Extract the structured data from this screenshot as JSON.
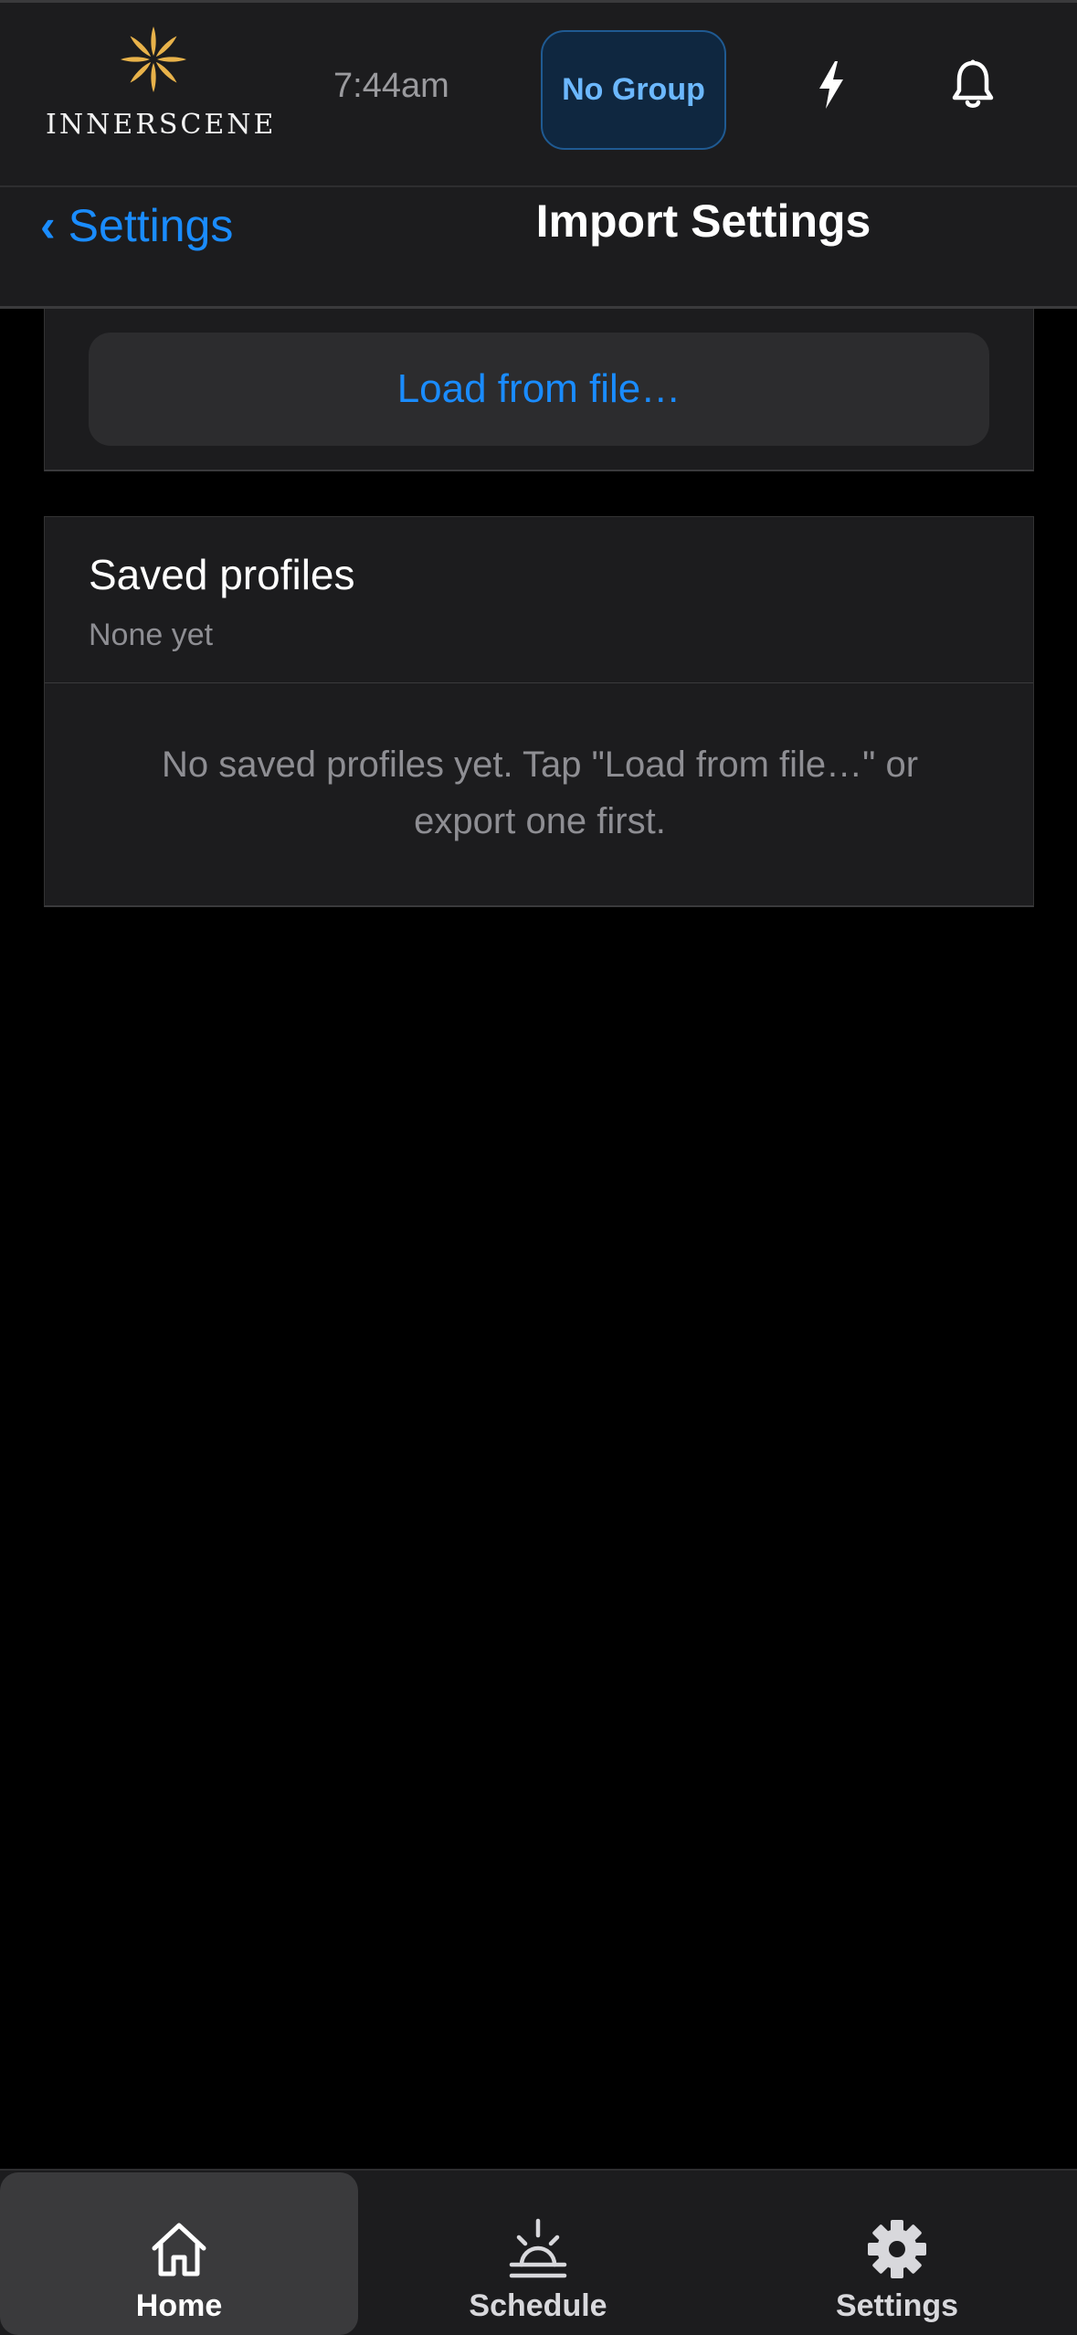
{
  "header": {
    "brand": "INNERSCENE",
    "time": "7:44am",
    "group_label": "No Group",
    "icons": {
      "logo": "sunburst-logo",
      "power": "lightning-bolt-icon",
      "notifications": "bell-icon"
    },
    "colors": {
      "logo_gold": "#e8b24a",
      "group_text": "#6cb8ff",
      "group_border": "#1f5a92"
    }
  },
  "nav": {
    "back_label": "Settings",
    "back_chevron": "‹",
    "title": "Import Settings"
  },
  "load": {
    "button_label": "Load from file…"
  },
  "profiles": {
    "title": "Saved profiles",
    "subtitle": "None yet",
    "empty_message": "No saved profiles yet. Tap \"Load from file…\" or export one first."
  },
  "tabs": [
    {
      "label": "Home",
      "icon": "home-icon",
      "active": true
    },
    {
      "label": "Schedule",
      "icon": "sunrise-icon",
      "active": false
    },
    {
      "label": "Settings",
      "icon": "gear-icon",
      "active": false
    }
  ],
  "accent_color": "#1a8cff"
}
